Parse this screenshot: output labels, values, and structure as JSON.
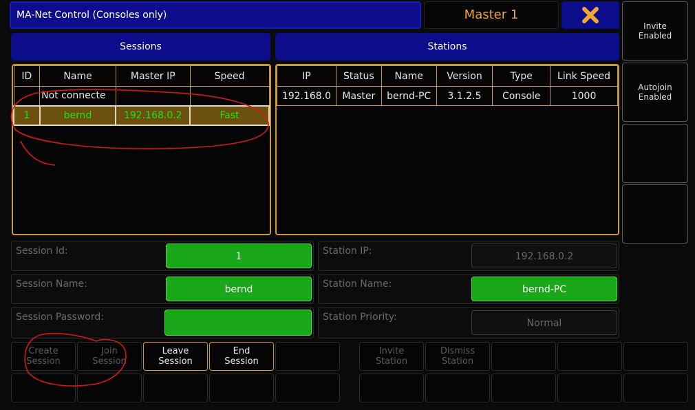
{
  "title": "MA-Net Control (Consoles only)",
  "master_label": "Master 1",
  "side_buttons": [
    {
      "line1": "Invite",
      "line2": "Enabled"
    },
    {
      "line1": "Autojoin",
      "line2": "Enabled"
    },
    {
      "line1": "",
      "line2": ""
    },
    {
      "line1": "",
      "line2": ""
    }
  ],
  "sessions": {
    "heading": "Sessions",
    "columns": [
      "ID",
      "Name",
      "Master IP",
      "Speed"
    ],
    "rows": [
      {
        "id": "",
        "name": "Not connecte",
        "master_ip": "",
        "speed": ""
      },
      {
        "id": "1",
        "name": "bernd",
        "master_ip": "192.168.0.2",
        "speed": "Fast"
      }
    ]
  },
  "stations": {
    "heading": "Stations",
    "columns": [
      "IP",
      "Status",
      "Name",
      "Version",
      "Type",
      "Link Speed"
    ],
    "rows": [
      {
        "ip": "192.168.0",
        "status": "Master",
        "name": "bernd-PC",
        "version": "3.1.2.5",
        "type": "Console",
        "link_speed": "1000"
      }
    ]
  },
  "session_fields": [
    {
      "label": "Session Id:",
      "value": "1"
    },
    {
      "label": "Session Name:",
      "value": "bernd"
    },
    {
      "label": "Session Password:",
      "value": ""
    }
  ],
  "station_fields": [
    {
      "label": "Station IP:",
      "value": "192.168.0.2"
    },
    {
      "label": "Station Name:",
      "value": "bernd-PC"
    },
    {
      "label": "Station Priority:",
      "value": "Normal"
    }
  ],
  "bottom_buttons": {
    "create_session": {
      "line1": "Create",
      "line2": "Session"
    },
    "join_session": {
      "line1": "Join",
      "line2": "Session"
    },
    "leave_session": {
      "line1": "Leave",
      "line2": "Session"
    },
    "end_session": {
      "line1": "End",
      "line2": "Session"
    },
    "invite_station": {
      "line1": "Invite",
      "line2": "Station"
    },
    "dismiss_station": {
      "line1": "Dismiss",
      "line2": "Station"
    }
  },
  "colors": {
    "header_blue": "#0b0d8a",
    "accent_orange": "#f2a33a",
    "grid_gold": "#c89a3c",
    "active_green": "#1aa81a",
    "selected_text_green": "#19e619",
    "annotation_red": "#d81818"
  },
  "icons": {
    "close": "close-x-icon"
  }
}
